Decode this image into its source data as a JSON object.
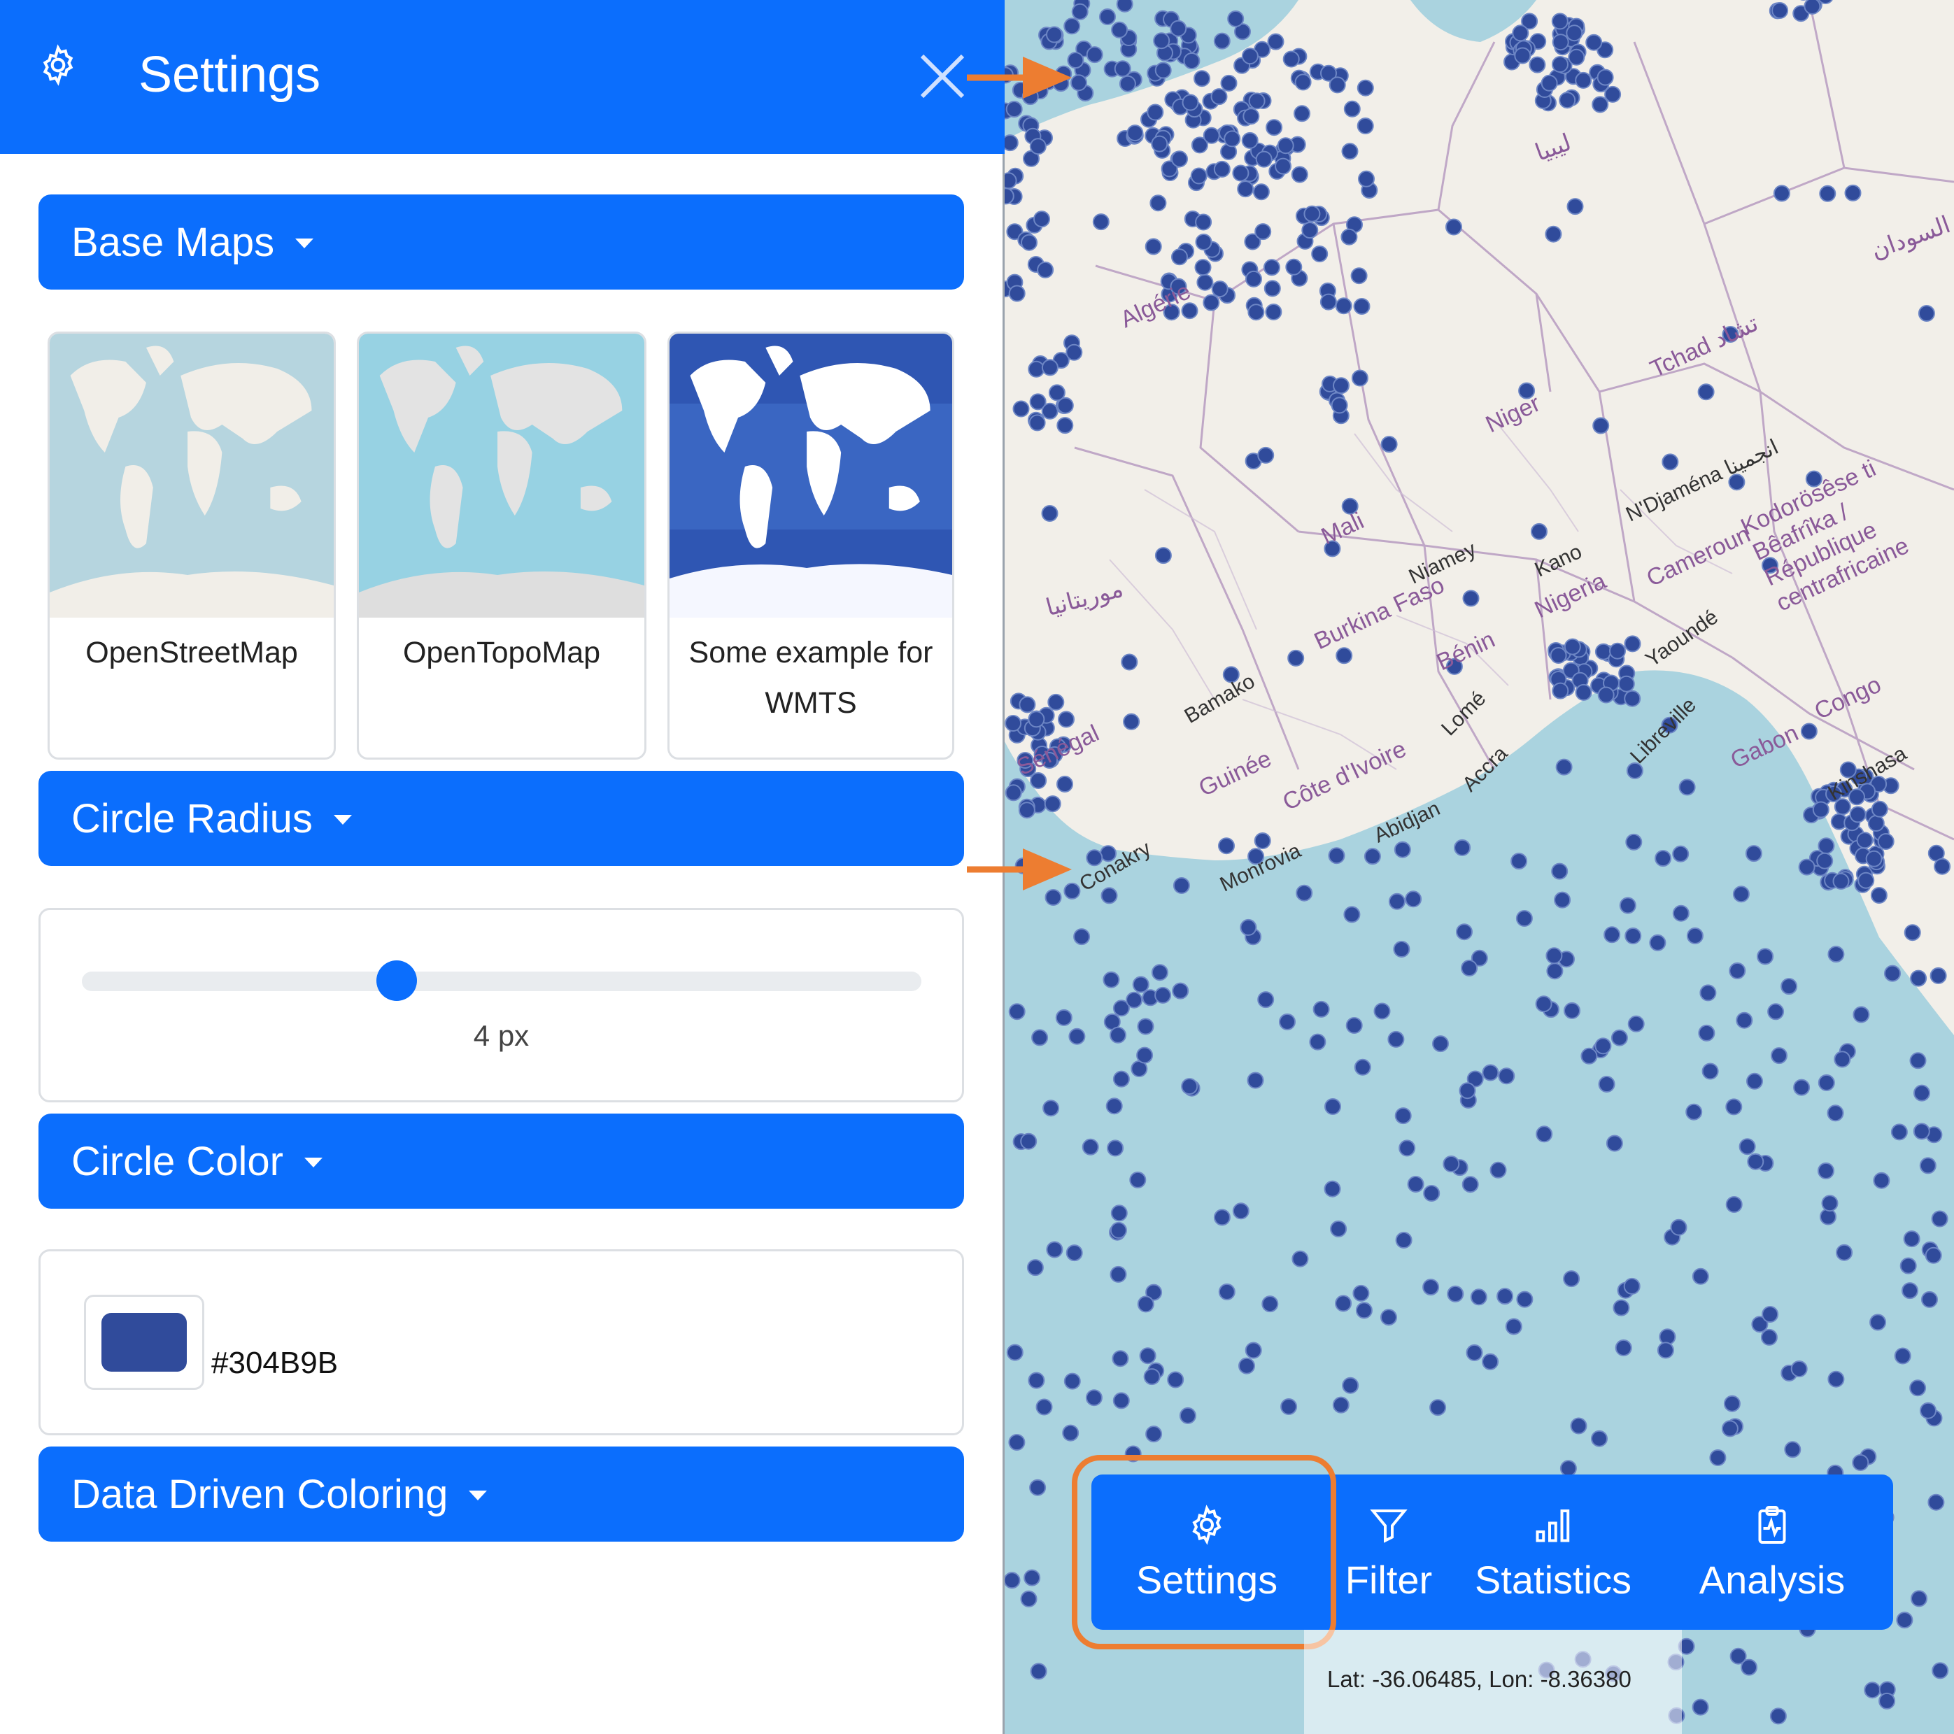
{
  "panel": {
    "title": "Settings",
    "header_icon": "gear-icon",
    "close_icon": "close-icon",
    "sections": {
      "base_maps": "Base Maps",
      "circle_radius": "Circle Radius",
      "circle_color": "Circle Color",
      "data_driven_coloring": "Data Driven Coloring"
    },
    "base_maps": [
      {
        "label": "OpenStreetMap"
      },
      {
        "label": "OpenTopoMap"
      },
      {
        "label_line1": "Some example for",
        "label_line2": "WMTS"
      }
    ],
    "radius": {
      "value": 4,
      "value_label": "4 px",
      "min": 1,
      "max": 9
    },
    "color": {
      "hex_label": "#304B9B",
      "value": "#304B9B"
    }
  },
  "map": {
    "country_labels": [
      "Algérie",
      "ليبيا",
      "Tchad تشاد",
      "Niger",
      "Mali",
      "Burkina Faso",
      "Bénin",
      "Nigeria",
      "Cameroun",
      "Kodorösêse ti Bêafrîka / République centrafricaine",
      "Gabon",
      "Congo",
      "Guinée",
      "Côte d'Ivoire",
      "موريتانيا",
      "السودان",
      "Sénégal"
    ],
    "city_labels": [
      "N'Djaména انجمينا",
      "Niamey",
      "Kano",
      "Bamako",
      "Lomé",
      "Accra",
      "Abidjan",
      "Monrovia",
      "Conakry",
      "Libreville",
      "Yaoundé",
      "Kinshasa"
    ]
  },
  "toolbar": {
    "items": [
      {
        "label": "Settings",
        "icon": "gear-icon"
      },
      {
        "label": "Filter",
        "icon": "filter-icon"
      },
      {
        "label": "Statistics",
        "icon": "bar-chart-icon"
      },
      {
        "label": "Analysis",
        "icon": "clipboard-pulse-icon"
      }
    ]
  },
  "coordinates": {
    "text": "Lat: -36.06485, Lon: -8.36380"
  },
  "colors": {
    "primary": "#0b6efd",
    "highlight": "#ed7d31",
    "ocean": "#aad3df",
    "land": "#f2efe9",
    "marker": "#304B9B"
  }
}
